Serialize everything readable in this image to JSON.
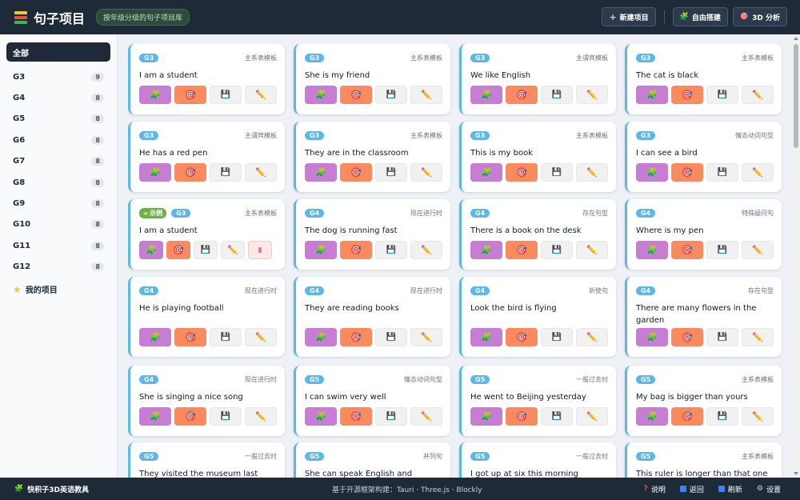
{
  "header": {
    "title": "句子项目",
    "subtitle": "按年级分级的句子项目库",
    "buttons": [
      {
        "label": "新建项目",
        "icon": "plus-icon"
      },
      {
        "label": "自由搭建",
        "icon": "puzzle-icon"
      },
      {
        "label": "3D 分析",
        "icon": "target-icon"
      }
    ]
  },
  "sidebar": {
    "all_label": "全部",
    "grades": [
      {
        "label": "G3",
        "count": "9"
      },
      {
        "label": "G4",
        "count": "8"
      },
      {
        "label": "G5",
        "count": "8"
      },
      {
        "label": "G6",
        "count": "8"
      },
      {
        "label": "G7",
        "count": "8"
      },
      {
        "label": "G8",
        "count": "8"
      },
      {
        "label": "G9",
        "count": "8"
      },
      {
        "label": "G10",
        "count": "8"
      },
      {
        "label": "G11",
        "count": "8"
      },
      {
        "label": "G12",
        "count": "8"
      }
    ],
    "mine_label": "我的项目"
  },
  "cards": [
    {
      "grade": "G3",
      "template": "主系表模板",
      "sentence": "I am a student"
    },
    {
      "grade": "G3",
      "template": "主系表模板",
      "sentence": "She is my friend"
    },
    {
      "grade": "G3",
      "template": "主谓宾模板",
      "sentence": "We like English"
    },
    {
      "grade": "G3",
      "template": "主系表模板",
      "sentence": "The cat is black"
    },
    {
      "grade": "G3",
      "template": "主谓宾模板",
      "sentence": "He has a red pen"
    },
    {
      "grade": "G3",
      "template": "主系表模板",
      "sentence": "They are in the classroom"
    },
    {
      "grade": "G3",
      "template": "主系表模板",
      "sentence": "This is my book"
    },
    {
      "grade": "G3",
      "template": "情态动词句型",
      "sentence": "I can see a bird"
    },
    {
      "grade": "G3",
      "template": "主系表模板",
      "sentence": "I am a student",
      "example": "示例"
    },
    {
      "grade": "G4",
      "template": "现在进行时",
      "sentence": "The dog is running fast"
    },
    {
      "grade": "G4",
      "template": "存在句型",
      "sentence": "There is a book on the desk"
    },
    {
      "grade": "G4",
      "template": "特殊疑问句",
      "sentence": "Where is my pen"
    },
    {
      "grade": "G4",
      "template": "现在进行时",
      "sentence": "He is playing football"
    },
    {
      "grade": "G4",
      "template": "现在进行时",
      "sentence": "They are reading books"
    },
    {
      "grade": "G4",
      "template": "祈使句",
      "sentence": "Look the bird is flying"
    },
    {
      "grade": "G4",
      "template": "存在句型",
      "sentence": "There are many flowers in the garden"
    },
    {
      "grade": "G4",
      "template": "现在进行时",
      "sentence": "She is singing a nice song"
    },
    {
      "grade": "G5",
      "template": "情态动词句型",
      "sentence": "I can swim very well"
    },
    {
      "grade": "G5",
      "template": "一般过去时",
      "sentence": "He went to Beijing yesterday"
    },
    {
      "grade": "G5",
      "template": "主系表模板",
      "sentence": "My bag is bigger than yours"
    },
    {
      "grade": "G5",
      "template": "一般过去时",
      "sentence": "They visited the museum last week"
    },
    {
      "grade": "G5",
      "template": "并列句",
      "sentence": "She can speak English and Chinese"
    },
    {
      "grade": "G5",
      "template": "一般过去时",
      "sentence": "I got up at six this morning"
    },
    {
      "grade": "G5",
      "template": "主系表模板",
      "sentence": "This ruler is longer than that one"
    }
  ],
  "footer": {
    "brand": "快积子3D英语教具",
    "built_with": "基于开源框架构建：Tauri · Three.js · Blockly",
    "links": [
      {
        "label": "说明",
        "icon": "question-icon"
      },
      {
        "label": "返回",
        "icon": "back-icon"
      },
      {
        "label": "刷新",
        "icon": "refresh-icon"
      },
      {
        "label": "设置",
        "icon": "gear-icon"
      }
    ]
  },
  "colors": {
    "header_bg": "#1f2a38",
    "card_accent": "#5bb8e8",
    "puzzle_button": "#c77dd4",
    "target_button": "#fb8a5e",
    "example_tag": "#6ab04c"
  }
}
